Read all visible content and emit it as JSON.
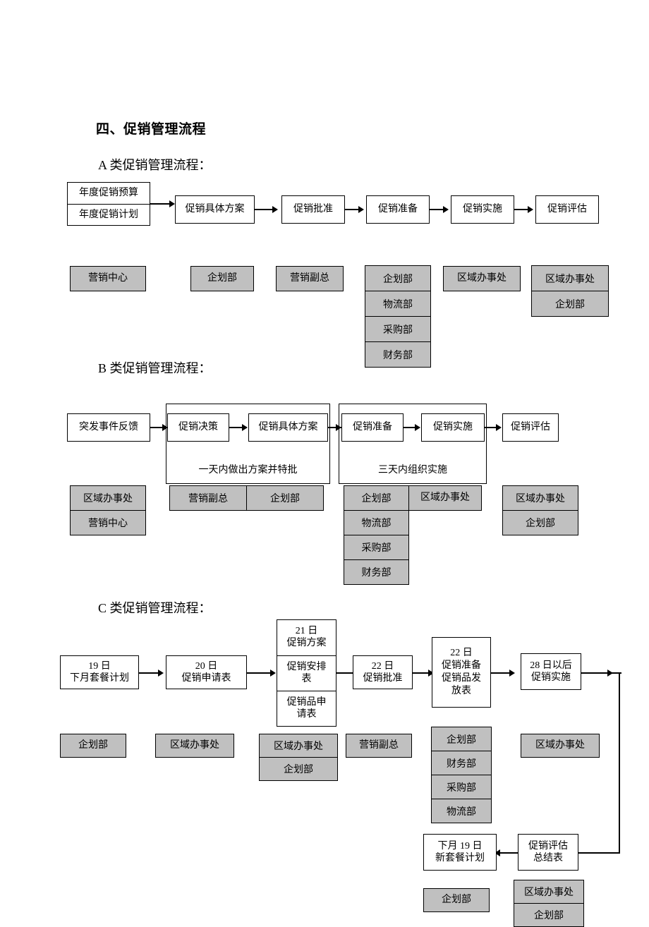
{
  "document": {
    "section_title": "四、促销管理流程",
    "subsections": [
      {
        "label": "A 类促销管理流程："
      },
      {
        "label": "B 类促销管理流程："
      },
      {
        "label": "C 类促销管理流程："
      }
    ]
  },
  "flow_a": {
    "source_box": {
      "line1": "年度促销预算",
      "line2": "年度促销计划"
    },
    "steps": [
      {
        "label": "促销具体方案"
      },
      {
        "label": "促销批准"
      },
      {
        "label": "促销准备"
      },
      {
        "label": "促销实施"
      },
      {
        "label": "促销评估"
      }
    ],
    "owners": {
      "source": "营销中心",
      "step1": "企划部",
      "step2": "营销副总",
      "step3_stack": [
        "企划部",
        "物流部",
        "采购部",
        "财务部"
      ],
      "step4": "区域办事处",
      "step5_stack": [
        "区域办事处",
        "企划部"
      ]
    }
  },
  "flow_b": {
    "source_box": {
      "label": "突发事件反馈"
    },
    "group1": {
      "note": "一天内做出方案并特批",
      "steps": [
        {
          "label": "促销决策"
        },
        {
          "label": "促销具体方案"
        }
      ],
      "owners": [
        "营销副总",
        "企划部"
      ]
    },
    "group2": {
      "note": "三天内组织实施",
      "steps": [
        {
          "label": "促销准备"
        },
        {
          "label": "促销实施"
        }
      ],
      "owners_left_stack": [
        "企划部",
        "物流部",
        "采购部",
        "财务部"
      ],
      "owners_right": "区域办事处"
    },
    "final_step": {
      "label": "促销评估"
    },
    "owners": {
      "source_stack": [
        "区域办事处",
        "营销中心"
      ],
      "final_stack": [
        "区域办事处",
        "企划部"
      ]
    }
  },
  "flow_c": {
    "steps": [
      {
        "cells": [
          "19 日",
          "下月套餐计划"
        ]
      },
      {
        "cells": [
          "20 日",
          "促销申请表"
        ]
      },
      {
        "cells": [
          "21 日\n促销方案",
          "促销安排\n表",
          "促销品申\n请表"
        ]
      },
      {
        "cells": [
          "22 日",
          "促销批准"
        ]
      },
      {
        "cells": [
          "22 日",
          "促销准备",
          "促销品发",
          "放表"
        ]
      },
      {
        "cells": [
          "28 日以后",
          "促销实施"
        ]
      }
    ],
    "step3_cells": {
      "c1_line1": "21 日",
      "c1_line2": "促销方案",
      "c2_line1": "促销安排",
      "c2_line2": "表",
      "c3_line1": "促销品申",
      "c3_line2": "请表"
    },
    "step5_cell": {
      "line1": "22 日",
      "line2": "促销准备",
      "line3": "促销品发",
      "line4": "放表"
    },
    "owners": {
      "step1": "企划部",
      "step2": "区域办事处",
      "step3_stack": [
        "区域办事处",
        "企划部"
      ],
      "step4": "营销副总",
      "step5_stack": [
        "企划部",
        "财务部",
        "采购部",
        "物流部"
      ],
      "step6": "区域办事处"
    },
    "summary_box": {
      "line1": "促销评估",
      "line2": "总结表"
    },
    "summary_owner_stack": [
      "区域办事处",
      "企划部"
    ],
    "next_plan_box": {
      "line1": "下月 19 日",
      "line2": "新套餐计划"
    },
    "next_plan_owner": "企划部"
  },
  "colors": {
    "gray_fill": "#c0c0c0",
    "line": "#000000",
    "page_background": "#ffffff"
  }
}
